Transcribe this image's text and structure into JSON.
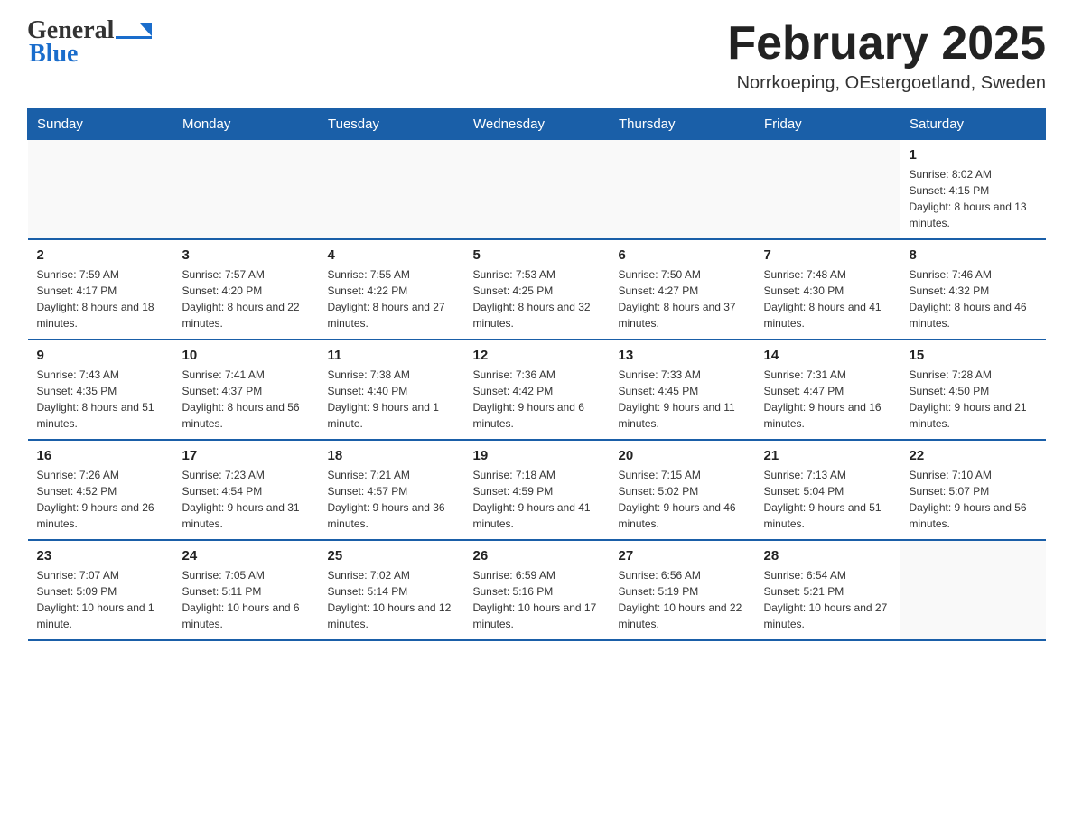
{
  "header": {
    "logo": {
      "general": "General",
      "blue": "Blue"
    },
    "title": "February 2025",
    "location": "Norrkoeping, OEstergoetland, Sweden"
  },
  "days_of_week": [
    "Sunday",
    "Monday",
    "Tuesday",
    "Wednesday",
    "Thursday",
    "Friday",
    "Saturday"
  ],
  "weeks": [
    {
      "cells": [
        {
          "day": null
        },
        {
          "day": null
        },
        {
          "day": null
        },
        {
          "day": null
        },
        {
          "day": null
        },
        {
          "day": null
        },
        {
          "day": "1",
          "sunrise": "Sunrise: 8:02 AM",
          "sunset": "Sunset: 4:15 PM",
          "daylight": "Daylight: 8 hours and 13 minutes."
        }
      ]
    },
    {
      "cells": [
        {
          "day": "2",
          "sunrise": "Sunrise: 7:59 AM",
          "sunset": "Sunset: 4:17 PM",
          "daylight": "Daylight: 8 hours and 18 minutes."
        },
        {
          "day": "3",
          "sunrise": "Sunrise: 7:57 AM",
          "sunset": "Sunset: 4:20 PM",
          "daylight": "Daylight: 8 hours and 22 minutes."
        },
        {
          "day": "4",
          "sunrise": "Sunrise: 7:55 AM",
          "sunset": "Sunset: 4:22 PM",
          "daylight": "Daylight: 8 hours and 27 minutes."
        },
        {
          "day": "5",
          "sunrise": "Sunrise: 7:53 AM",
          "sunset": "Sunset: 4:25 PM",
          "daylight": "Daylight: 8 hours and 32 minutes."
        },
        {
          "day": "6",
          "sunrise": "Sunrise: 7:50 AM",
          "sunset": "Sunset: 4:27 PM",
          "daylight": "Daylight: 8 hours and 37 minutes."
        },
        {
          "day": "7",
          "sunrise": "Sunrise: 7:48 AM",
          "sunset": "Sunset: 4:30 PM",
          "daylight": "Daylight: 8 hours and 41 minutes."
        },
        {
          "day": "8",
          "sunrise": "Sunrise: 7:46 AM",
          "sunset": "Sunset: 4:32 PM",
          "daylight": "Daylight: 8 hours and 46 minutes."
        }
      ]
    },
    {
      "cells": [
        {
          "day": "9",
          "sunrise": "Sunrise: 7:43 AM",
          "sunset": "Sunset: 4:35 PM",
          "daylight": "Daylight: 8 hours and 51 minutes."
        },
        {
          "day": "10",
          "sunrise": "Sunrise: 7:41 AM",
          "sunset": "Sunset: 4:37 PM",
          "daylight": "Daylight: 8 hours and 56 minutes."
        },
        {
          "day": "11",
          "sunrise": "Sunrise: 7:38 AM",
          "sunset": "Sunset: 4:40 PM",
          "daylight": "Daylight: 9 hours and 1 minute."
        },
        {
          "day": "12",
          "sunrise": "Sunrise: 7:36 AM",
          "sunset": "Sunset: 4:42 PM",
          "daylight": "Daylight: 9 hours and 6 minutes."
        },
        {
          "day": "13",
          "sunrise": "Sunrise: 7:33 AM",
          "sunset": "Sunset: 4:45 PM",
          "daylight": "Daylight: 9 hours and 11 minutes."
        },
        {
          "day": "14",
          "sunrise": "Sunrise: 7:31 AM",
          "sunset": "Sunset: 4:47 PM",
          "daylight": "Daylight: 9 hours and 16 minutes."
        },
        {
          "day": "15",
          "sunrise": "Sunrise: 7:28 AM",
          "sunset": "Sunset: 4:50 PM",
          "daylight": "Daylight: 9 hours and 21 minutes."
        }
      ]
    },
    {
      "cells": [
        {
          "day": "16",
          "sunrise": "Sunrise: 7:26 AM",
          "sunset": "Sunset: 4:52 PM",
          "daylight": "Daylight: 9 hours and 26 minutes."
        },
        {
          "day": "17",
          "sunrise": "Sunrise: 7:23 AM",
          "sunset": "Sunset: 4:54 PM",
          "daylight": "Daylight: 9 hours and 31 minutes."
        },
        {
          "day": "18",
          "sunrise": "Sunrise: 7:21 AM",
          "sunset": "Sunset: 4:57 PM",
          "daylight": "Daylight: 9 hours and 36 minutes."
        },
        {
          "day": "19",
          "sunrise": "Sunrise: 7:18 AM",
          "sunset": "Sunset: 4:59 PM",
          "daylight": "Daylight: 9 hours and 41 minutes."
        },
        {
          "day": "20",
          "sunrise": "Sunrise: 7:15 AM",
          "sunset": "Sunset: 5:02 PM",
          "daylight": "Daylight: 9 hours and 46 minutes."
        },
        {
          "day": "21",
          "sunrise": "Sunrise: 7:13 AM",
          "sunset": "Sunset: 5:04 PM",
          "daylight": "Daylight: 9 hours and 51 minutes."
        },
        {
          "day": "22",
          "sunrise": "Sunrise: 7:10 AM",
          "sunset": "Sunset: 5:07 PM",
          "daylight": "Daylight: 9 hours and 56 minutes."
        }
      ]
    },
    {
      "cells": [
        {
          "day": "23",
          "sunrise": "Sunrise: 7:07 AM",
          "sunset": "Sunset: 5:09 PM",
          "daylight": "Daylight: 10 hours and 1 minute."
        },
        {
          "day": "24",
          "sunrise": "Sunrise: 7:05 AM",
          "sunset": "Sunset: 5:11 PM",
          "daylight": "Daylight: 10 hours and 6 minutes."
        },
        {
          "day": "25",
          "sunrise": "Sunrise: 7:02 AM",
          "sunset": "Sunset: 5:14 PM",
          "daylight": "Daylight: 10 hours and 12 minutes."
        },
        {
          "day": "26",
          "sunrise": "Sunrise: 6:59 AM",
          "sunset": "Sunset: 5:16 PM",
          "daylight": "Daylight: 10 hours and 17 minutes."
        },
        {
          "day": "27",
          "sunrise": "Sunrise: 6:56 AM",
          "sunset": "Sunset: 5:19 PM",
          "daylight": "Daylight: 10 hours and 22 minutes."
        },
        {
          "day": "28",
          "sunrise": "Sunrise: 6:54 AM",
          "sunset": "Sunset: 5:21 PM",
          "daylight": "Daylight: 10 hours and 27 minutes."
        },
        {
          "day": null
        }
      ]
    }
  ]
}
